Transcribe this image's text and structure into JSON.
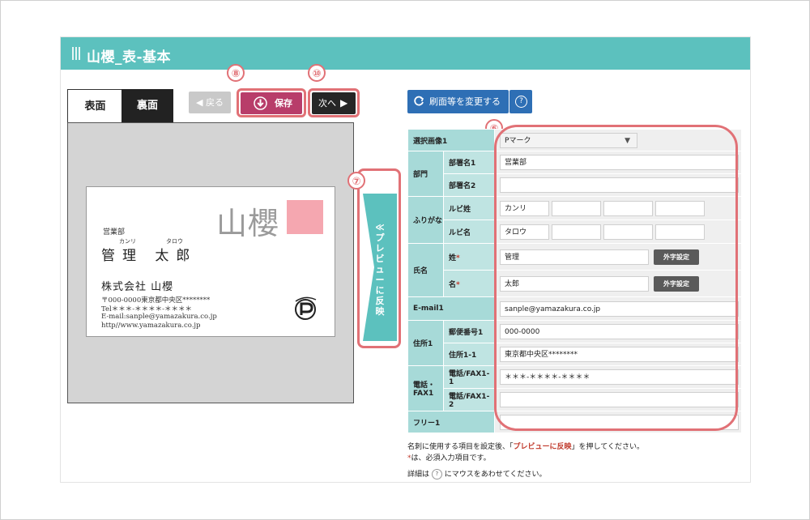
{
  "title": "山櫻_表-基本",
  "tabs": {
    "front": "表面",
    "back": "裏面"
  },
  "buttons": {
    "back": "戻る",
    "save": "保存",
    "next": "次へ",
    "change": "刷面等を変更する",
    "gaiji": "外字設定",
    "help": "?"
  },
  "markers": {
    "form": "⑥",
    "preview": "⑦",
    "save": "⑧",
    "next": "⑩"
  },
  "preview_tab": "≪ プレビューに反映",
  "card": {
    "logo": "山櫻",
    "dept": "営業部",
    "ruby_last": "カンリ",
    "ruby_first": "タロウ",
    "name": "管理 太郎",
    "company": "株式会社 山櫻",
    "address": "〒000-0000東京都中央区********",
    "tel": "Tel＊＊＊-＊＊＊＊-＊＊＊＊",
    "email": "E-mail:sanple@yamazakura.co.jp",
    "url": "http//www.yamazakura.co.jp"
  },
  "form": {
    "image_label": "選択画像1",
    "image_value": "Pマーク",
    "dept_group": "部門",
    "dept1_label": "部署名1",
    "dept1_value": "営業部",
    "dept2_label": "部署名2",
    "furigana_group": "ふりがな",
    "ruby_last_label": "ルビ姓",
    "ruby_last_value": "カンリ",
    "ruby_first_label": "ルビ名",
    "ruby_first_value": "タロウ",
    "name_group": "氏名",
    "last_label": "姓",
    "last_value": "管理",
    "first_label": "名",
    "first_value": "太郎",
    "required_mark": "*",
    "email_label": "E-mail1",
    "email_value": "sanple@yamazakura.co.jp",
    "address_group": "住所1",
    "zip_label": "郵便番号1",
    "zip_value": "000-0000",
    "addr_label": "住所1-1",
    "addr_value": "東京都中央区********",
    "phone_group": "電話・FAX1",
    "phone1_label": "電話/FAX1-1",
    "phone1_value": "＊＊＊-＊＊＊＊-＊＊＊＊",
    "phone2_label": "電話/FAX1-2",
    "free_label": "フリー1"
  },
  "notes": {
    "line1_pre": "名刺に使用する項目を設定後、「",
    "line1_red": "プレビューに反映",
    "line1_post": "」を押してください。",
    "line2_mark": "*",
    "line2_text": "は、必須入力項目です。",
    "line3_pre": "詳細は",
    "line3_post": "にマウスをあわせてください。"
  }
}
